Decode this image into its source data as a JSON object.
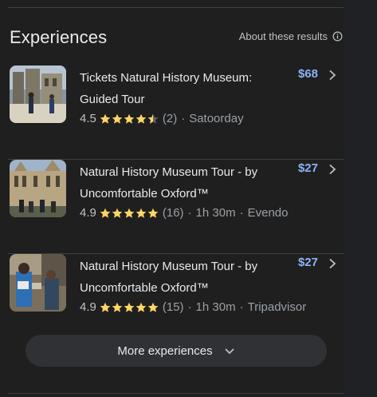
{
  "section": {
    "title": "Experiences",
    "about_label": "About these results"
  },
  "experiences": [
    {
      "name": "Tickets Natural History Museum: Guided Tour",
      "price": "$68",
      "rating": "4.5",
      "stars_value": 4.5,
      "reviews": "(2)",
      "duration": "",
      "source": "Satoorday"
    },
    {
      "name": "Natural History Museum Tour - by Uncomfortable Oxford™",
      "price": "$27",
      "rating": "4.9",
      "stars_value": 4.9,
      "reviews": "(16)",
      "duration": "1h 30m",
      "source": "Evendo"
    },
    {
      "name": "Natural History Museum Tour - by Uncomfortable Oxford™",
      "price": "$27",
      "rating": "4.9",
      "stars_value": 4.9,
      "reviews": "(15)",
      "duration": "1h 30m",
      "source": "Tripadvisor"
    }
  ],
  "more_button": {
    "label": "More experiences"
  },
  "separator": "·",
  "colors": {
    "background": "#1f1f1f",
    "price": "#8ab4f8",
    "star": "#fdd663",
    "button_bg": "#303134"
  }
}
